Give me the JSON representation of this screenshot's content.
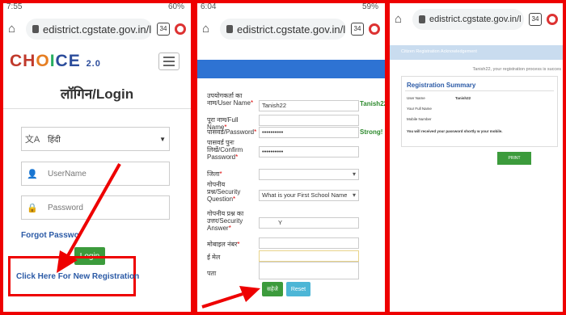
{
  "screens": [
    {
      "status_time": "7:55",
      "status_battery": "60%",
      "url": "edistrict.cgstate.gov.in/l",
      "tab_count": "34",
      "logo": {
        "ch": "CH",
        "o": "O",
        "i": "I",
        "ce": "CE",
        "version": "2.0"
      },
      "title": "लॉगिन/Login",
      "language": "हिंदी",
      "username_placeholder": "UserName",
      "password_placeholder": "Password",
      "forgot_password": "Forgot Passwo",
      "login_button": "Login",
      "new_registration": "Click Here For New Registration"
    },
    {
      "status_time": "6:04",
      "status_battery": "59%",
      "url": "edistrict.cgstate.gov.in/l",
      "tab_count": "34",
      "form": {
        "username_label": "उपयोगकर्ता का नाम/User Name",
        "username_value": "Tanish22",
        "username_check": "Tanish22",
        "fullname_label": "पूरा नाम/Full Name",
        "password_label": "पासवर्ड/Password",
        "password_value": "••••••••••",
        "password_strength": "Strong!",
        "confirm_label": "पासवर्ड पुनः लिखें/Confirm Password",
        "confirm_value": "••••••••••",
        "district_label": "जिला",
        "question_label": "गोपनीय प्रश्न/Security Question",
        "question_value": "What is your First School Name",
        "answer_label": "गोपनीय प्रश्न का उत्तर/Security Answer",
        "answer_value": "Y",
        "mobile_label": "मोबाइल नंबर",
        "email_label": "ई मेल",
        "address_label": "पता",
        "submit_button": "सहेजे",
        "reset_button": "Reset"
      }
    },
    {
      "url": "edistrict.cgstate.gov.in/l",
      "tab_count": "34",
      "band_text": "Citizen Registration Acknowledgement",
      "message": "Tanish22, your registration process is succes",
      "summary_title": "Registration Summary",
      "user_name_label": "User Name",
      "user_name_value": "Tanish22",
      "full_name_label": "Your Full Name",
      "mobile_label": "Mobile Number",
      "note": "You will received your password shortly w your mobile.",
      "print_button": "PRINT"
    }
  ],
  "colors": {
    "annotation": "#ee0000",
    "primary_button": "#3c9b3c",
    "header_band": "#2e73d3"
  }
}
